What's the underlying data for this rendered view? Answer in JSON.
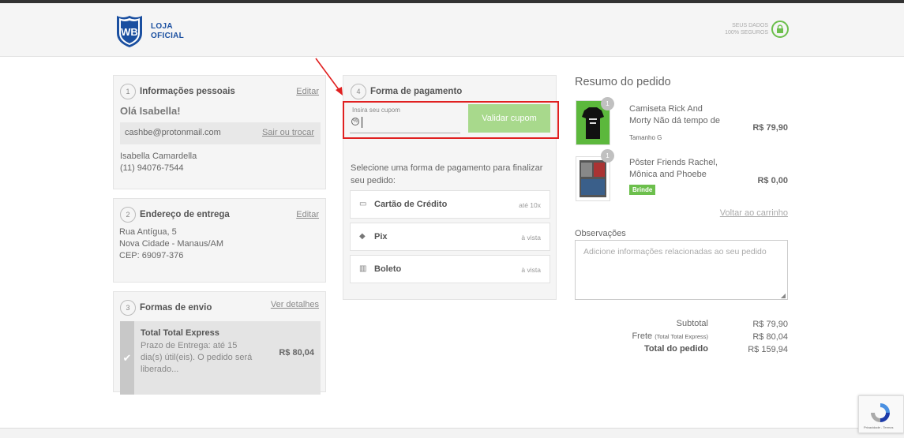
{
  "header": {
    "logo_line1": "LOJA",
    "logo_line2": "OFICIAL",
    "secure_line1": "SEUS DADOS",
    "secure_line2": "100% SEGUROS"
  },
  "personal": {
    "step": "1",
    "title": "Informações pessoais",
    "edit": "Editar",
    "greeting": "Olá Isabella!",
    "email": "cashbe@protonmail.com",
    "switch": "Sair ou trocar",
    "name": "Isabella Camardella",
    "phone": "(11) 94076-7544"
  },
  "address": {
    "step": "2",
    "title": "Endereço de entrega",
    "edit": "Editar",
    "line1": "Rua Antígua, 5",
    "line2": "Nova Cidade - Manaus/AM",
    "line3": "CEP: 69097-376"
  },
  "shipping": {
    "step": "3",
    "title": "Formas de envio",
    "details": "Ver detalhes",
    "option_name": "Total Total Express",
    "option_desc_1": "Prazo de Entrega: até 15",
    "option_desc_2": "dia(s) útil(eis). O pedido será",
    "option_desc_3": "liberado...",
    "option_price": "R$ 80,04"
  },
  "payment": {
    "step": "4",
    "title": "Forma de pagamento",
    "coupon_label": "Insira seu cupom",
    "coupon_button": "Validar cupom",
    "instruction": "Selecione uma forma de pagamento para finalizar seu pedido:",
    "options": [
      {
        "label": "Cartão de Crédito",
        "note": "até 10x",
        "icon": "credit-card-icon"
      },
      {
        "label": "Pix",
        "note": "à vista",
        "icon": "pix-icon"
      },
      {
        "label": "Boleto",
        "note": "à vista",
        "icon": "barcode-icon"
      }
    ]
  },
  "summary": {
    "title": "Resumo do pedido",
    "items": [
      {
        "qty": "1",
        "name": "Camiseta Rick And Morty Não dá tempo de",
        "variant": "Tamanho G",
        "price": "R$ 79,90"
      },
      {
        "qty": "1",
        "name": "Pôster Friends Rachel, Mônica and Phoebe",
        "tag": "Brinde",
        "price": "R$ 0,00"
      }
    ],
    "back_to_cart": "Voltar ao carrinho",
    "notes_label": "Observações",
    "notes_placeholder": "Adicione informações relacionadas ao seu pedido",
    "subtotal_label": "Subtotal",
    "subtotal_value": "R$ 79,90",
    "shipping_label": "Frete",
    "shipping_method": "(Total Total Express)",
    "shipping_value": "R$ 80,04",
    "total_label": "Total do pedido",
    "total_value": "R$ 159,94"
  },
  "recaptcha": {
    "text": "Privacidade - Termos"
  },
  "colors": {
    "brand_blue": "#1a4fa0",
    "accent_green": "#6cbf4c",
    "highlight_red": "#e02020"
  }
}
